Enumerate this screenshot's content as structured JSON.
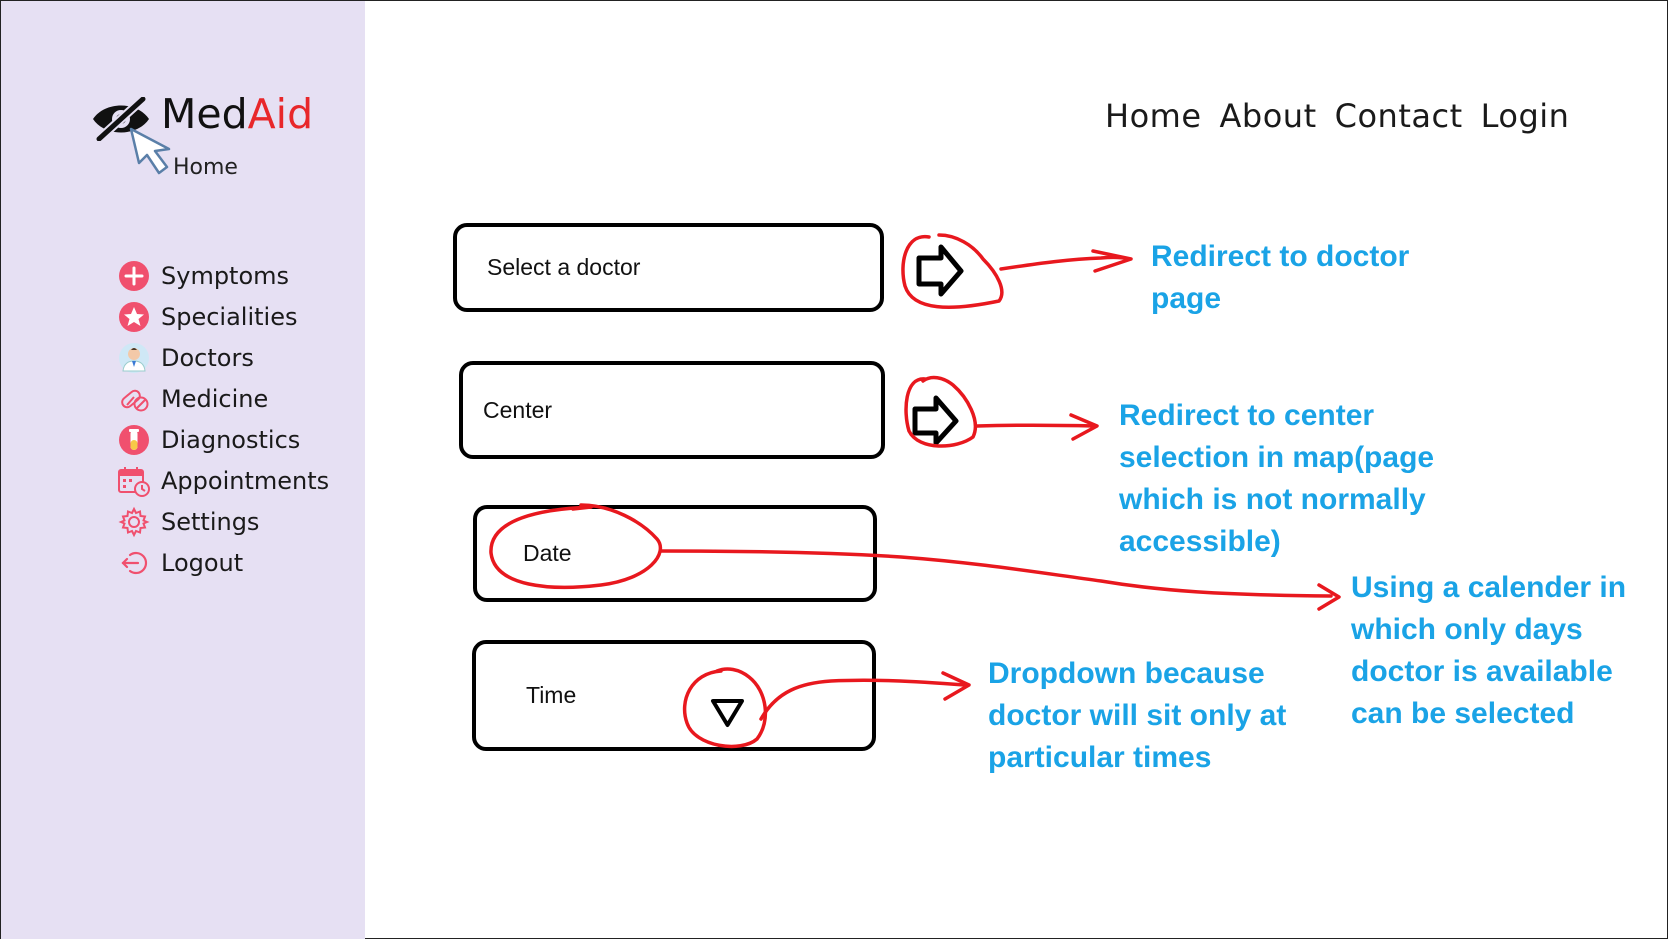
{
  "app": {
    "logo_left": "Med",
    "logo_right": "Aid",
    "logo_sub": "Home"
  },
  "sidebar": {
    "items": [
      {
        "label": "Symptoms",
        "icon": "plus-circle-icon"
      },
      {
        "label": "Specialities",
        "icon": "star-badge-icon"
      },
      {
        "label": "Doctors",
        "icon": "doctor-avatar-icon"
      },
      {
        "label": "Medicine",
        "icon": "pill-icon"
      },
      {
        "label": "Diagnostics",
        "icon": "test-tube-icon"
      },
      {
        "label": "Appointments",
        "icon": "calendar-clock-icon"
      },
      {
        "label": "Settings",
        "icon": "gear-icon"
      },
      {
        "label": "Logout",
        "icon": "logout-icon"
      }
    ]
  },
  "nav": {
    "home": "Home",
    "about": "About",
    "contact": "Contact",
    "login": "Login"
  },
  "form": {
    "doctor_placeholder": "Select a doctor",
    "center_placeholder": "Center",
    "date_placeholder": "Date",
    "time_placeholder": "Time"
  },
  "annotations": {
    "doctor": "Redirect to doctor page",
    "center": "Redirect to center selection in map(page which is not normally accessible)",
    "date": "Using a calender in which only days doctor is available can be selected",
    "time": "Dropdown because doctor will sit only at particular times"
  },
  "colors": {
    "sidebar_bg": "#e6e0f3",
    "accent_red": "#e8272a",
    "annotation_blue": "#1aa3e6",
    "icon_red": "#f0506e"
  }
}
